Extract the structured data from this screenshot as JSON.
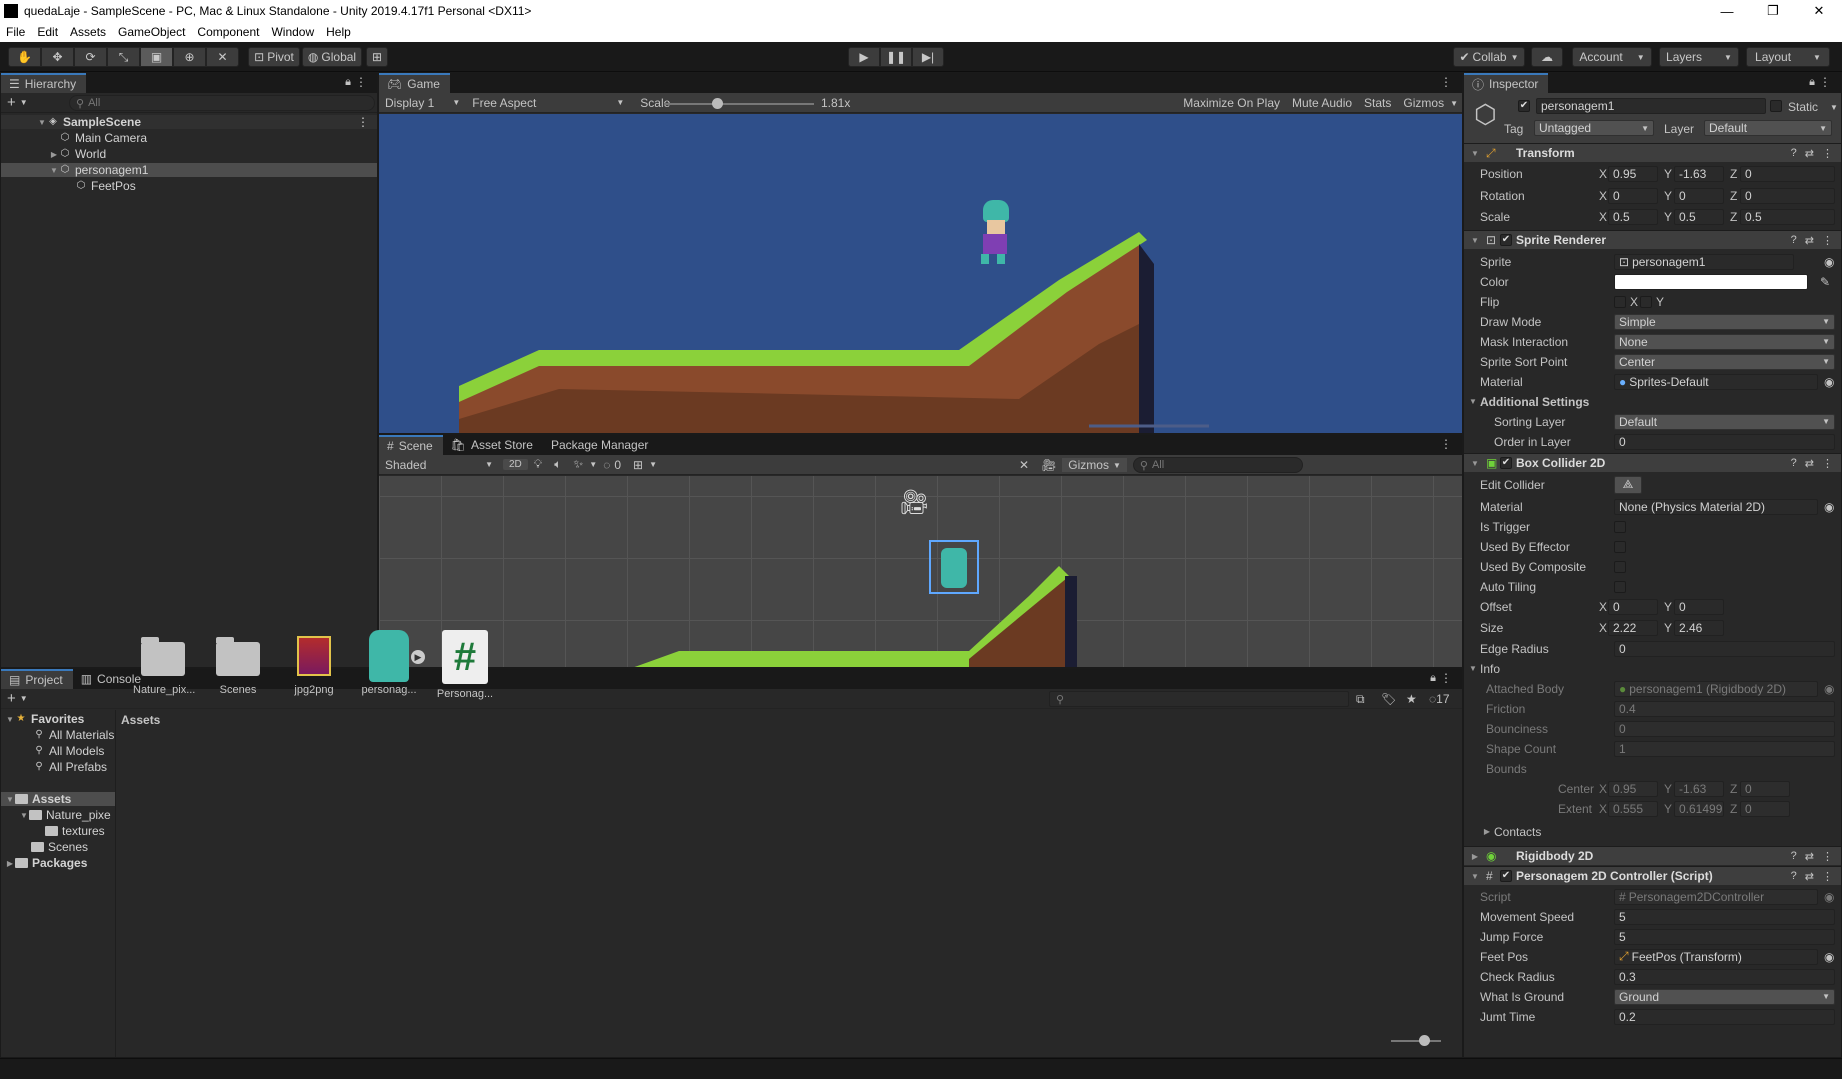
{
  "window": {
    "title": "quedaLaje - SampleScene - PC, Mac & Linux Standalone - Unity 2019.4.17f1 Personal <DX11>",
    "controls": [
      "—",
      "❐",
      "✕"
    ]
  },
  "menu": [
    "File",
    "Edit",
    "Assets",
    "GameObject",
    "Component",
    "Window",
    "Help"
  ],
  "toolbar": {
    "pivot": "Pivot",
    "global": "Global",
    "collab": "Collab",
    "account": "Account",
    "layers": "Layers",
    "layout": "Layout"
  },
  "hierarchy": {
    "tab": "Hierarchy",
    "search_placeholder": "All",
    "items": [
      {
        "label": "SampleScene",
        "depth": 0,
        "bold": true
      },
      {
        "label": "Main Camera",
        "depth": 1
      },
      {
        "label": "World",
        "depth": 1
      },
      {
        "label": "personagem1",
        "depth": 1,
        "selected": true
      },
      {
        "label": "FeetPos",
        "depth": 2
      }
    ]
  },
  "game": {
    "tab": "Game",
    "display": "Display 1",
    "aspect": "Free Aspect",
    "scale_label": "Scale",
    "scale_value": "1.81x",
    "scale_slider_fraction": 0.35,
    "maximize": "Maximize On Play",
    "mute": "Mute Audio",
    "stats": "Stats",
    "gizmos": "Gizmos",
    "bg_color": "#2f4f8a"
  },
  "scene": {
    "tabs": [
      "Scene",
      "Asset Store",
      "Package Manager"
    ],
    "shading": "Shaded",
    "mode2d": "2D",
    "hidden_count": "0",
    "gizmos": "Gizmos",
    "search_placeholder": "All"
  },
  "project": {
    "tabs": [
      "Project",
      "Console"
    ],
    "hidden_count": "17",
    "favorites_label": "Favorites",
    "favorites": [
      "All Materials",
      "All Models",
      "All Prefabs"
    ],
    "tree_assets": "Assets",
    "tree_children": [
      "Nature_pixe",
      "textures",
      "Scenes"
    ],
    "tree_packages": "Packages",
    "breadcrumb": "Assets",
    "assets": [
      {
        "label": "Nature_pix...",
        "kind": "folder"
      },
      {
        "label": "Scenes",
        "kind": "folder"
      },
      {
        "label": "jpg2png",
        "kind": "archive"
      },
      {
        "label": "personag...",
        "kind": "sprite"
      },
      {
        "label": "Personag...",
        "kind": "script"
      }
    ]
  },
  "inspector": {
    "tab": "Inspector",
    "object_name": "personagem1",
    "static_label": "Static",
    "tag_label": "Tag",
    "tag_value": "Untagged",
    "layer_label": "Layer",
    "layer_value": "Default",
    "transform": {
      "title": "Transform",
      "position_label": "Position",
      "rotation_label": "Rotation",
      "scale_label": "Scale",
      "position": [
        "0.95",
        "-1.63",
        "0"
      ],
      "rotation": [
        "0",
        "0",
        "0"
      ],
      "scale": [
        "0.5",
        "0.5",
        "0.5"
      ]
    },
    "sprite_renderer": {
      "title": "Sprite Renderer",
      "rows": [
        {
          "label": "Sprite",
          "value": "personagem1"
        },
        {
          "label": "Color",
          "value": ""
        },
        {
          "label": "Flip",
          "value": ""
        },
        {
          "label": "Draw Mode",
          "value": "Simple"
        },
        {
          "label": "Mask Interaction",
          "value": "None"
        },
        {
          "label": "Sprite Sort Point",
          "value": "Center"
        },
        {
          "label": "Material",
          "value": "Sprites-Default"
        }
      ],
      "flip_x": "X",
      "flip_y": "Y",
      "additional": "Additional Settings",
      "sorting_layer_label": "Sorting Layer",
      "sorting_layer": "Default",
      "order_label": "Order in Layer",
      "order": "0"
    },
    "box_collider": {
      "title": "Box Collider 2D",
      "edit_collider": "Edit Collider",
      "material_label": "Material",
      "material": "None (Physics Material 2D)",
      "is_trigger": "Is Trigger",
      "used_by_effector": "Used By Effector",
      "used_by_composite": "Used By Composite",
      "auto_tiling": "Auto Tiling",
      "offset_label": "Offset",
      "offset": [
        "0",
        "0"
      ],
      "size_label": "Size",
      "size": [
        "2.22",
        "2.46"
      ],
      "edge_radius_label": "Edge Radius",
      "edge_radius": "0",
      "info": "Info",
      "attached_body_label": "Attached Body",
      "attached_body": "personagem1 (Rigidbody 2D)",
      "friction_label": "Friction",
      "friction": "0.4",
      "bounciness_label": "Bounciness",
      "bounciness": "0",
      "shape_count_label": "Shape Count",
      "shape_count": "1",
      "bounds_label": "Bounds",
      "center_label": "Center",
      "center": [
        "0.95",
        "-1.63",
        "0"
      ],
      "extent_label": "Extent",
      "extent": [
        "0.555",
        "0.61499",
        "0"
      ],
      "contacts": "Contacts"
    },
    "rigidbody": {
      "title": "Rigidbody 2D"
    },
    "controller": {
      "title": "Personagem 2D Controller (Script)",
      "script_label": "Script",
      "script": "Personagem2DController",
      "movement_speed_label": "Movement Speed",
      "movement_speed": "5",
      "jump_force_label": "Jump Force",
      "jump_force": "5",
      "feet_pos_label": "Feet Pos",
      "feet_pos": "FeetPos (Transform)",
      "check_radius_label": "Check Radius",
      "check_radius": "0.3",
      "what_is_ground_label": "What Is Ground",
      "what_is_ground": "Ground",
      "jump_time_label": "Jumt Time",
      "jump_time": "0.2"
    },
    "axes": {
      "x": "X",
      "y": "Y",
      "z": "Z"
    }
  },
  "colors": {
    "accent": "#3a79bb",
    "grass": "#8bd13a",
    "dirt": "#8a4a2c",
    "scene_bg": "#464646"
  }
}
